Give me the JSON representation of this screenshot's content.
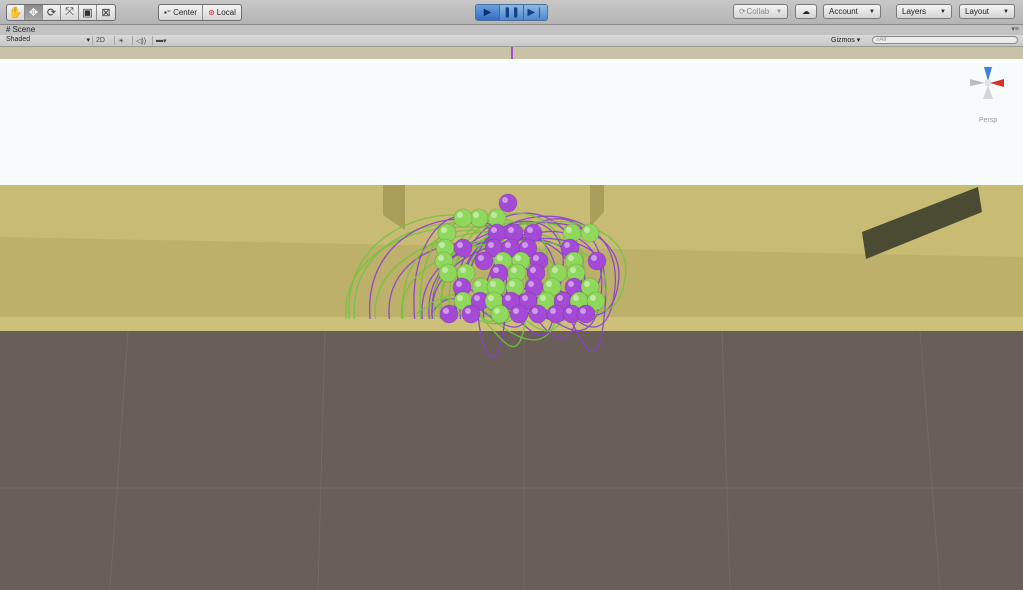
{
  "toolbar": {
    "tools": [
      {
        "name": "hand-tool-icon",
        "glyph": "✋"
      },
      {
        "name": "move-tool-icon",
        "glyph": "✥"
      },
      {
        "name": "rotate-tool-icon",
        "glyph": "⟳"
      },
      {
        "name": "scale-tool-icon",
        "glyph": "⤧"
      },
      {
        "name": "rect-tool-icon",
        "glyph": "▣"
      },
      {
        "name": "transform-tool-icon",
        "glyph": "⊠"
      }
    ],
    "active_tool": "move-tool-icon",
    "pivot_label": "Center",
    "rotation_label": "Local",
    "collab_label": "Collab",
    "account_label": "Account",
    "layers_label": "Layers",
    "layout_label": "Layout"
  },
  "scene_tab": {
    "title": "Scene"
  },
  "scene_toolbar": {
    "shading_mode": "Shaded",
    "mode_2d_label": "2D",
    "gizmos_label": "Gizmos",
    "search_placeholder": "All"
  },
  "orientation_gizmo": {
    "label": "Persp",
    "x_color": "#d9322c",
    "y_color": "#3b7fe0",
    "z_color": "#bcbcbc"
  },
  "scene": {
    "sky_color": "#f7fbfb",
    "wall_color": "#bdb06a",
    "floor_color": "#6a5e58",
    "particle_colors": {
      "purple": "#a44ad6",
      "green": "#8ed85c"
    }
  }
}
